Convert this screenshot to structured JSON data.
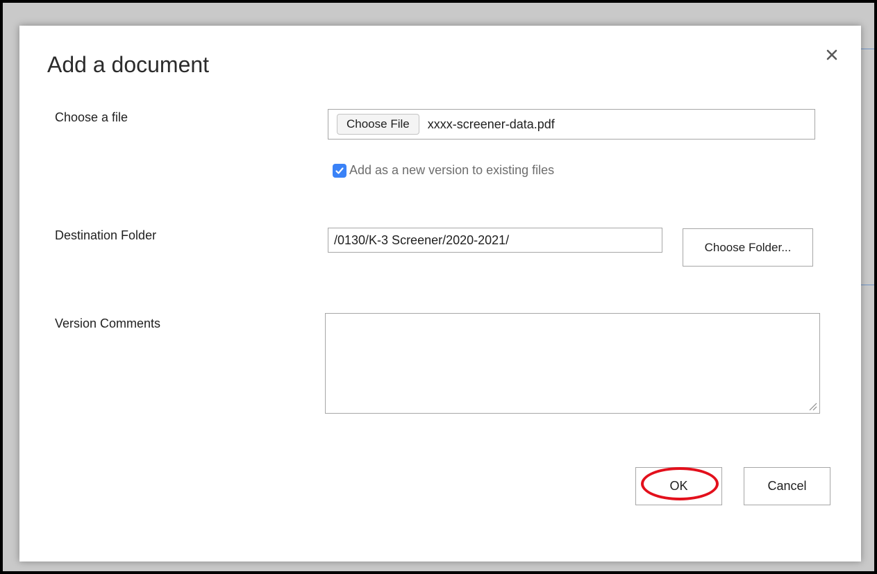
{
  "dialog": {
    "title": "Add a document",
    "close_icon": "close-icon"
  },
  "file": {
    "label": "Choose a file",
    "button_label": "Choose File",
    "file_name": "xxxx-screener-data.pdf"
  },
  "version_option": {
    "checked": true,
    "label": "Add as a new version to existing files"
  },
  "destination": {
    "label": "Destination Folder",
    "value": "/0130/K-3 Screener/2020-2021/",
    "button_label": "Choose Folder..."
  },
  "comments": {
    "label": "Version Comments",
    "value": ""
  },
  "footer": {
    "ok_label": "OK",
    "cancel_label": "Cancel"
  },
  "colors": {
    "checkbox_accent": "#3a82f7",
    "highlight_ring": "#e3101c",
    "frame_border": "#000000"
  }
}
